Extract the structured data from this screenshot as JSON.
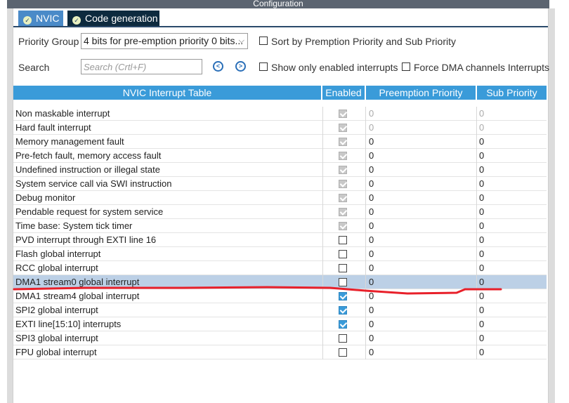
{
  "window": {
    "title": "Configuration"
  },
  "tabs": [
    {
      "label": "NVIC",
      "active": false
    },
    {
      "label": "Code generation",
      "active": true
    }
  ],
  "controls": {
    "priority_group_label": "Priority Group",
    "priority_group_value": "4 bits for pre-emption priority 0 bits...",
    "sort_label": "Sort by Premption Priority and Sub Priority",
    "search_label": "Search",
    "search_placeholder": "Search (Crtl+F)",
    "show_enabled_label": "Show only enabled interrupts",
    "force_dma_label": "Force DMA channels Interrupts"
  },
  "table": {
    "headers": [
      "NVIC Interrupt Table",
      "Enabled",
      "Preemption Priority",
      "Sub Priority"
    ],
    "rows": [
      {
        "name": "Non maskable interrupt",
        "enabled": true,
        "locked": true,
        "pre": "0",
        "sub": "0",
        "gray": true
      },
      {
        "name": "Hard fault interrupt",
        "enabled": true,
        "locked": true,
        "pre": "0",
        "sub": "0",
        "gray": true
      },
      {
        "name": "Memory management fault",
        "enabled": true,
        "locked": true,
        "pre": "0",
        "sub": "0"
      },
      {
        "name": "Pre-fetch fault, memory access fault",
        "enabled": true,
        "locked": true,
        "pre": "0",
        "sub": "0"
      },
      {
        "name": "Undefined instruction or illegal state",
        "enabled": true,
        "locked": true,
        "pre": "0",
        "sub": "0"
      },
      {
        "name": "System service call via SWI instruction",
        "enabled": true,
        "locked": true,
        "pre": "0",
        "sub": "0"
      },
      {
        "name": "Debug monitor",
        "enabled": true,
        "locked": true,
        "pre": "0",
        "sub": "0"
      },
      {
        "name": "Pendable request for system service",
        "enabled": true,
        "locked": true,
        "pre": "0",
        "sub": "0"
      },
      {
        "name": "Time base: System tick timer",
        "enabled": true,
        "locked": true,
        "pre": "0",
        "sub": "0"
      },
      {
        "name": "PVD interrupt through EXTI line 16",
        "enabled": false,
        "pre": "0",
        "sub": "0"
      },
      {
        "name": "Flash global interrupt",
        "enabled": false,
        "pre": "0",
        "sub": "0"
      },
      {
        "name": "RCC global interrupt",
        "enabled": false,
        "pre": "0",
        "sub": "0"
      },
      {
        "name": "DMA1 stream0 global interrupt",
        "enabled": false,
        "pre": "0",
        "sub": "0",
        "selected": true
      },
      {
        "name": "DMA1 stream4 global interrupt",
        "enabled": true,
        "pre": "0",
        "sub": "0"
      },
      {
        "name": "SPI2 global interrupt",
        "enabled": true,
        "pre": "0",
        "sub": "0"
      },
      {
        "name": "EXTI line[15:10] interrupts",
        "enabled": true,
        "pre": "0",
        "sub": "0"
      },
      {
        "name": "SPI3 global interrupt",
        "enabled": false,
        "pre": "0",
        "sub": "0"
      },
      {
        "name": "FPU global interrupt",
        "enabled": false,
        "pre": "0",
        "sub": "0"
      }
    ]
  },
  "colors": {
    "header_blue": "#3a9bd9",
    "tab_active": "#0d2a3e",
    "tab_inactive": "#4a8ac8",
    "selected_row": "#bcd0e6",
    "annotation_red": "#e8202a"
  },
  "icons": {
    "tab_check": "check-circle-icon",
    "prev": "chevron-left-circle-icon",
    "next": "chevron-right-circle-icon",
    "dropdown": "chevron-down-icon"
  }
}
